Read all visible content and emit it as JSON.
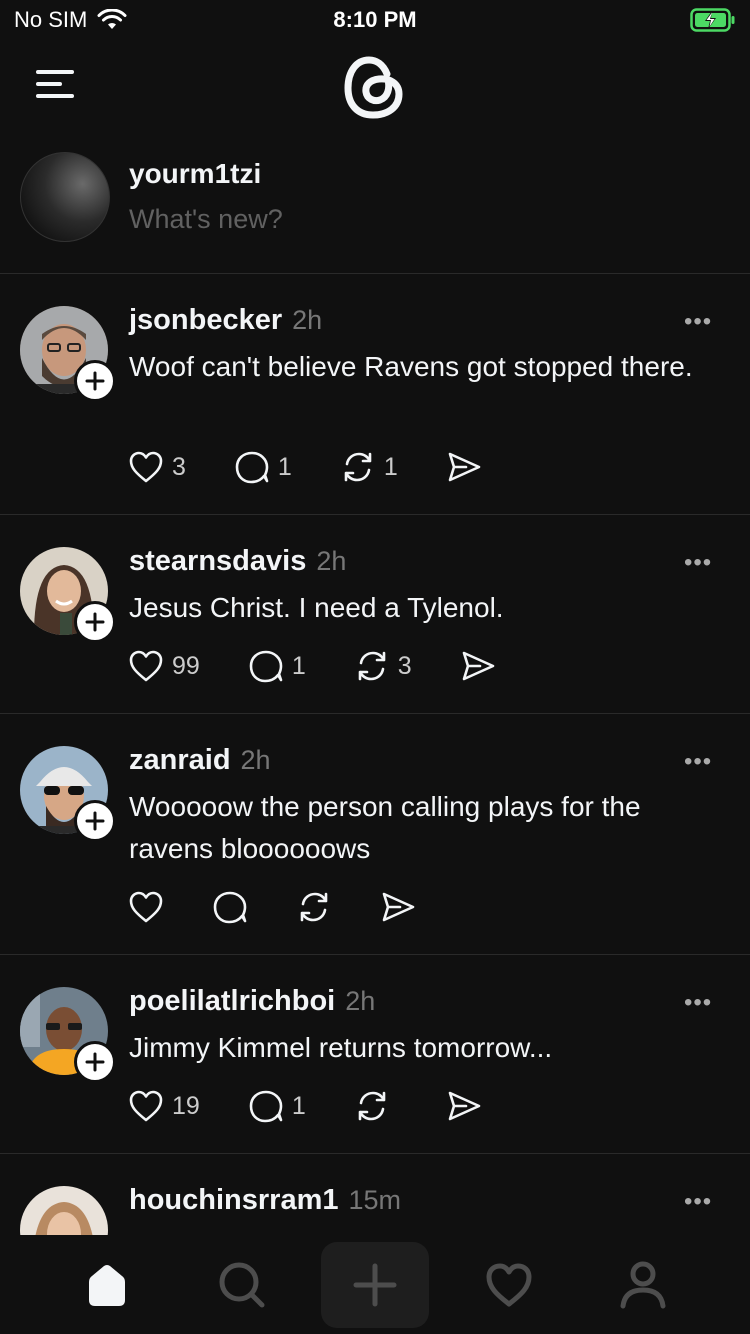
{
  "status_bar": {
    "carrier": "No SIM",
    "time": "8:10 PM"
  },
  "composer": {
    "username": "yourm1tzi",
    "placeholder": "What's new?"
  },
  "posts": [
    {
      "username": "jsonbecker",
      "time": "2h",
      "text": "Woof can't believe Ravens got stopped there.",
      "likes": "3",
      "replies": "1",
      "reposts": "1"
    },
    {
      "username": "stearnsdavis",
      "time": "2h",
      "text": "Jesus Christ. I need a Tylenol.",
      "likes": "99",
      "replies": "1",
      "reposts": "3"
    },
    {
      "username": "zanraid",
      "time": "2h",
      "text": "Wooooow the person calling plays for the ravens bloooooows",
      "likes": "",
      "replies": "",
      "reposts": ""
    },
    {
      "username": "poelilatlrichboi",
      "time": "2h",
      "text": "Jimmy Kimmel returns tomorrow...",
      "likes": "19",
      "replies": "1",
      "reposts": ""
    },
    {
      "username": "houchinsrram1",
      "time": "15m",
      "text": ""
    }
  ],
  "more_label": "•••",
  "icons": {
    "menu": "menu-icon",
    "logo": "threads-logo",
    "like": "heart-icon",
    "reply": "comment-icon",
    "repost": "repost-icon",
    "share": "send-icon",
    "home": "home-icon",
    "search": "search-icon",
    "create": "plus-icon",
    "activity": "heart-icon",
    "profile": "profile-icon"
  },
  "colors": {
    "background": "#101010",
    "text": "#f3f5f7",
    "muted": "#777777",
    "battery": "#4cd964"
  }
}
